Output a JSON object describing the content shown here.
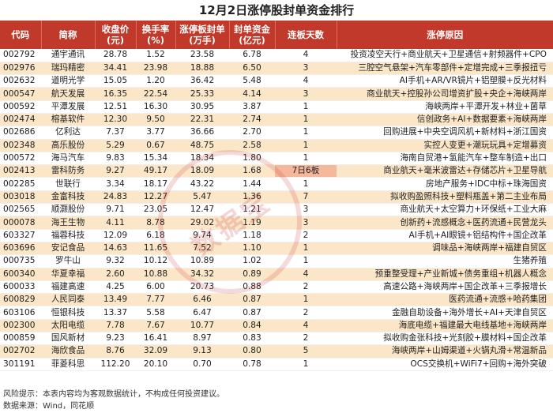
{
  "title": "12月2日涨停股封单资金排行",
  "headers": [
    "代码",
    "简称",
    "收盘价\n(元)",
    "换手率\n(%)",
    "涨停板封单\n(万手)",
    "封单资金\n(亿元)",
    "连板天数",
    "涨停原因"
  ],
  "rows": [
    [
      "002792",
      "通宇通讯",
      "28.78",
      "1.52",
      "23.58",
      "6.78",
      "4",
      "投资凌空天行+商业航天+卫星通信+射频器件+CPO"
    ],
    [
      "002976",
      "瑞玛精密",
      "34.41",
      "23.98",
      "18.88",
      "6.50",
      "3",
      "三腔空气悬架+汽车零部件+定增完成+三季报扭亏"
    ],
    [
      "002632",
      "道明光学",
      "15.05",
      "1.20",
      "36.42",
      "5.48",
      "4",
      "AI手机+AR/VR镜片+铝塑膜+反光材料"
    ],
    [
      "000547",
      "航天发展",
      "16.35",
      "22.54",
      "25.33",
      "4.14",
      "3",
      "商业航天+控股孙公司增资扩股+央企+海峡两岸"
    ],
    [
      "000592",
      "平潭发展",
      "12.51",
      "16.30",
      "30.95",
      "3.87",
      "1",
      "海峡两岸+平潭开发+林业+菌草"
    ],
    [
      "002474",
      "榕基软件",
      "12.30",
      "9.50",
      "22.31",
      "2.74",
      "1",
      "信创政务+AI+数据要素+海峡两岸"
    ],
    [
      "002686",
      "亿利达",
      "7.37",
      "3.77",
      "36.66",
      "2.70",
      "1",
      "回购进展+中央空调风机+新材料+浙江国资"
    ],
    [
      "002348",
      "高乐股份",
      "5.29",
      "0.67",
      "48.75",
      "2.58",
      "1",
      "实控人变更+潮玩玩具+定增募资"
    ],
    [
      "000572",
      "海马汽车",
      "9.83",
      "15.34",
      "18.34",
      "1.80",
      "1",
      "海南自贸港+氢能汽车+整车制造+出口"
    ],
    [
      "002413",
      "雷科防务",
      "9.27",
      "49.17",
      "18.09",
      "1.68",
      "7日6板",
      "商业航天+毫米波雷达+存储芯片+卫星导航"
    ],
    [
      "002285",
      "世联行",
      "3.34",
      "18.17",
      "43.22",
      "1.44",
      "1",
      "房地产服务+IDC中标+珠海国资"
    ],
    [
      "003018",
      "金富科技",
      "24.83",
      "12.27",
      "5.47",
      "1.36",
      "7",
      "拟收购盈照科技+塑料瓶盖+第二主业布局"
    ],
    [
      "002565",
      "顺灏股份",
      "9.71",
      "23.05",
      "12.47",
      "1.21",
      "3",
      "商业航天+太空算力+环保纸+工业大麻"
    ],
    [
      "000078",
      "海王生物",
      "4.11",
      "8.78",
      "29.02",
      "1.19",
      "3",
      "创新药+流感概念+医药流通+民营龙头"
    ],
    [
      "603327",
      "福蓉科技",
      "12.09",
      "6.18",
      "9.74",
      "1.18",
      "2",
      "AI手机+AI眼镜+铝结构件+国企改革"
    ],
    [
      "603696",
      "安记食品",
      "14.63",
      "11.65",
      "7.52",
      "1.10",
      "1",
      "调味品+海峡两岸+福建自贸区"
    ],
    [
      "000735",
      "罗牛山",
      "9.32",
      "10.12",
      "10.89",
      "1.02",
      "1",
      "生猪养殖"
    ],
    [
      "600340",
      "华夏幸福",
      "2.60",
      "10.88",
      "34.32",
      "0.89",
      "4",
      "预重整受理+产业新城+债务重组+机器人概念"
    ],
    [
      "600033",
      "福建高速",
      "4.25",
      "6.00",
      "20.73",
      "0.88",
      "2",
      "高速公路+海峡两岸+国企改革+三季报增长"
    ],
    [
      "600829",
      "人民同泰",
      "13.49",
      "7.77",
      "6.46",
      "0.87",
      "1",
      "医药流通+流感+哈药集团"
    ],
    [
      "603106",
      "恒银科技",
      "13.37",
      "5.58",
      "6.47",
      "0.87",
      "2",
      "金融自助设备+海外增长+AI+天津自贸区"
    ],
    [
      "002300",
      "太阳电缆",
      "7.78",
      "7.67",
      "10.77",
      "0.84",
      "4",
      "海底电缆+福建最大电线基地+海峡两岸"
    ],
    [
      "000859",
      "国风新材",
      "9.23",
      "16.41",
      "8.97",
      "0.83",
      "2",
      "拟收购金张科技+光刻胶+膜材料+国企改革"
    ],
    [
      "002702",
      "海欣食品",
      "8.76",
      "32.09",
      "9.13",
      "0.80",
      "5",
      "海峡两岸+山姆渠道+火锅丸滑+常温新品"
    ],
    [
      "301191",
      "菲菱科思",
      "112.20",
      "20.10",
      "0.70",
      "0.78",
      "1",
      "OCS交换机+WiFi7+回购+海外突破"
    ]
  ],
  "highlighted_cell": "7日6板",
  "footer": {
    "risk": "风险提示：本表内容均为客观数据统计，不构成任何投资建议。",
    "source": "数据来源：Wind，同花顺"
  },
  "watermark_text": "数据宝",
  "colors": {
    "header_bg": "#c0392b",
    "stripe": "#fbe7c8",
    "highlight": "#f6b89a"
  }
}
